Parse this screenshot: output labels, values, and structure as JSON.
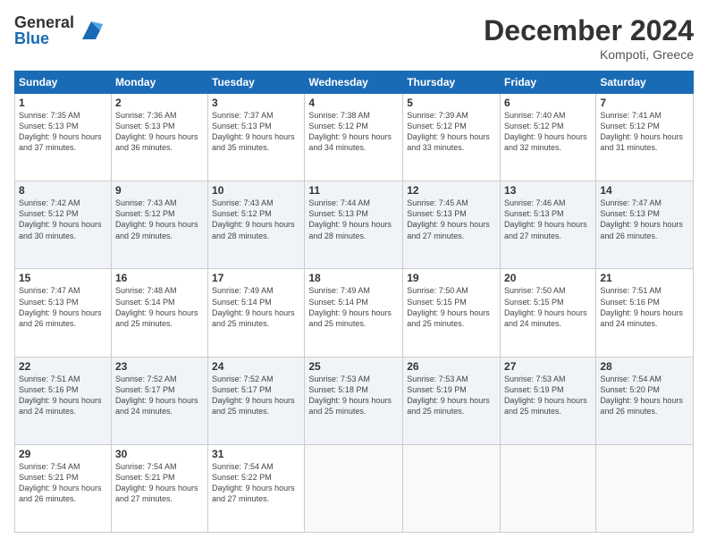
{
  "logo": {
    "general": "General",
    "blue": "Blue"
  },
  "header": {
    "month": "December 2024",
    "location": "Kompoti, Greece"
  },
  "weekdays": [
    "Sunday",
    "Monday",
    "Tuesday",
    "Wednesday",
    "Thursday",
    "Friday",
    "Saturday"
  ],
  "weeks": [
    [
      {
        "day": "1",
        "sunrise": "7:35 AM",
        "sunset": "5:13 PM",
        "daylight": "9 hours and 37 minutes."
      },
      {
        "day": "2",
        "sunrise": "7:36 AM",
        "sunset": "5:13 PM",
        "daylight": "9 hours and 36 minutes."
      },
      {
        "day": "3",
        "sunrise": "7:37 AM",
        "sunset": "5:13 PM",
        "daylight": "9 hours and 35 minutes."
      },
      {
        "day": "4",
        "sunrise": "7:38 AM",
        "sunset": "5:12 PM",
        "daylight": "9 hours and 34 minutes."
      },
      {
        "day": "5",
        "sunrise": "7:39 AM",
        "sunset": "5:12 PM",
        "daylight": "9 hours and 33 minutes."
      },
      {
        "day": "6",
        "sunrise": "7:40 AM",
        "sunset": "5:12 PM",
        "daylight": "9 hours and 32 minutes."
      },
      {
        "day": "7",
        "sunrise": "7:41 AM",
        "sunset": "5:12 PM",
        "daylight": "9 hours and 31 minutes."
      }
    ],
    [
      {
        "day": "8",
        "sunrise": "7:42 AM",
        "sunset": "5:12 PM",
        "daylight": "9 hours and 30 minutes."
      },
      {
        "day": "9",
        "sunrise": "7:43 AM",
        "sunset": "5:12 PM",
        "daylight": "9 hours and 29 minutes."
      },
      {
        "day": "10",
        "sunrise": "7:43 AM",
        "sunset": "5:12 PM",
        "daylight": "9 hours and 28 minutes."
      },
      {
        "day": "11",
        "sunrise": "7:44 AM",
        "sunset": "5:13 PM",
        "daylight": "9 hours and 28 minutes."
      },
      {
        "day": "12",
        "sunrise": "7:45 AM",
        "sunset": "5:13 PM",
        "daylight": "9 hours and 27 minutes."
      },
      {
        "day": "13",
        "sunrise": "7:46 AM",
        "sunset": "5:13 PM",
        "daylight": "9 hours and 27 minutes."
      },
      {
        "day": "14",
        "sunrise": "7:47 AM",
        "sunset": "5:13 PM",
        "daylight": "9 hours and 26 minutes."
      }
    ],
    [
      {
        "day": "15",
        "sunrise": "7:47 AM",
        "sunset": "5:13 PM",
        "daylight": "9 hours and 26 minutes."
      },
      {
        "day": "16",
        "sunrise": "7:48 AM",
        "sunset": "5:14 PM",
        "daylight": "9 hours and 25 minutes."
      },
      {
        "day": "17",
        "sunrise": "7:49 AM",
        "sunset": "5:14 PM",
        "daylight": "9 hours and 25 minutes."
      },
      {
        "day": "18",
        "sunrise": "7:49 AM",
        "sunset": "5:14 PM",
        "daylight": "9 hours and 25 minutes."
      },
      {
        "day": "19",
        "sunrise": "7:50 AM",
        "sunset": "5:15 PM",
        "daylight": "9 hours and 25 minutes."
      },
      {
        "day": "20",
        "sunrise": "7:50 AM",
        "sunset": "5:15 PM",
        "daylight": "9 hours and 24 minutes."
      },
      {
        "day": "21",
        "sunrise": "7:51 AM",
        "sunset": "5:16 PM",
        "daylight": "9 hours and 24 minutes."
      }
    ],
    [
      {
        "day": "22",
        "sunrise": "7:51 AM",
        "sunset": "5:16 PM",
        "daylight": "9 hours and 24 minutes."
      },
      {
        "day": "23",
        "sunrise": "7:52 AM",
        "sunset": "5:17 PM",
        "daylight": "9 hours and 24 minutes."
      },
      {
        "day": "24",
        "sunrise": "7:52 AM",
        "sunset": "5:17 PM",
        "daylight": "9 hours and 25 minutes."
      },
      {
        "day": "25",
        "sunrise": "7:53 AM",
        "sunset": "5:18 PM",
        "daylight": "9 hours and 25 minutes."
      },
      {
        "day": "26",
        "sunrise": "7:53 AM",
        "sunset": "5:19 PM",
        "daylight": "9 hours and 25 minutes."
      },
      {
        "day": "27",
        "sunrise": "7:53 AM",
        "sunset": "5:19 PM",
        "daylight": "9 hours and 25 minutes."
      },
      {
        "day": "28",
        "sunrise": "7:54 AM",
        "sunset": "5:20 PM",
        "daylight": "9 hours and 26 minutes."
      }
    ],
    [
      {
        "day": "29",
        "sunrise": "7:54 AM",
        "sunset": "5:21 PM",
        "daylight": "9 hours and 26 minutes."
      },
      {
        "day": "30",
        "sunrise": "7:54 AM",
        "sunset": "5:21 PM",
        "daylight": "9 hours and 27 minutes."
      },
      {
        "day": "31",
        "sunrise": "7:54 AM",
        "sunset": "5:22 PM",
        "daylight": "9 hours and 27 minutes."
      },
      null,
      null,
      null,
      null
    ]
  ]
}
